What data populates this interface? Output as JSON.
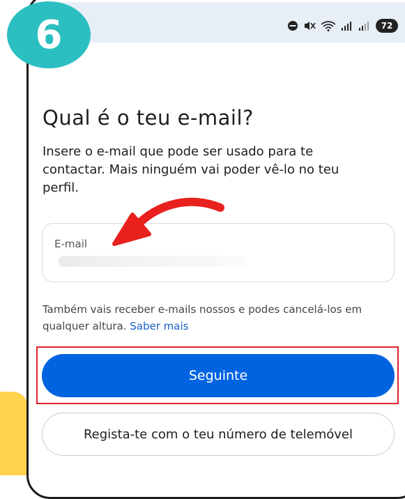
{
  "step": {
    "number": "6"
  },
  "status_bar": {
    "icons": [
      "do-not-disturb-icon",
      "mute-icon",
      "wifi-icon",
      "signal-icon",
      "signal-icon"
    ],
    "battery": "72"
  },
  "page": {
    "title": "Qual é o teu e-mail?",
    "description": "Insere o e-mail que pode ser usado para te contactar. Mais ninguém vai poder vê-lo no teu perfil."
  },
  "email_field": {
    "label": "E-mail",
    "value": ""
  },
  "info": {
    "text": "Também vais receber e-mails nossos e podes cancelá-los em qualquer altura.",
    "link": "Saber mais"
  },
  "buttons": {
    "next": "Seguinte",
    "phone_signup": "Regista-te com o teu número de telemóvel"
  },
  "colors": {
    "primary": "#0064e0",
    "badge": "#2bbfc1",
    "highlight": "#e0202a",
    "arrow": "#e8211f",
    "accent_yellow": "#ffd24d"
  }
}
